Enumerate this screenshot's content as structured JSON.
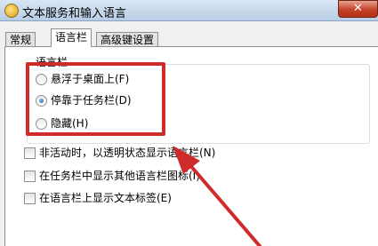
{
  "window": {
    "title": "文本服务和输入语言",
    "close_label": "✕"
  },
  "tabs": [
    {
      "label": "常规",
      "active": false
    },
    {
      "label": "语言栏",
      "active": true
    },
    {
      "label": "高级键设置",
      "active": false
    }
  ],
  "language_bar_group": {
    "label": "语言栏",
    "options": [
      {
        "label": "悬浮于桌面上(F)",
        "checked": false
      },
      {
        "label": "停靠于任务栏(D)",
        "checked": true
      },
      {
        "label": "隐藏(H)",
        "checked": false
      }
    ]
  },
  "checkboxes": [
    {
      "label": "非活动时，以透明状态显示语言栏(N)",
      "checked": false
    },
    {
      "label": "在任务栏中显示其他语言栏图标(I)",
      "checked": false
    },
    {
      "label": "在语言栏上显示文本标签(E)",
      "checked": false
    }
  ],
  "annotation": {
    "color": "#d02b2b"
  }
}
